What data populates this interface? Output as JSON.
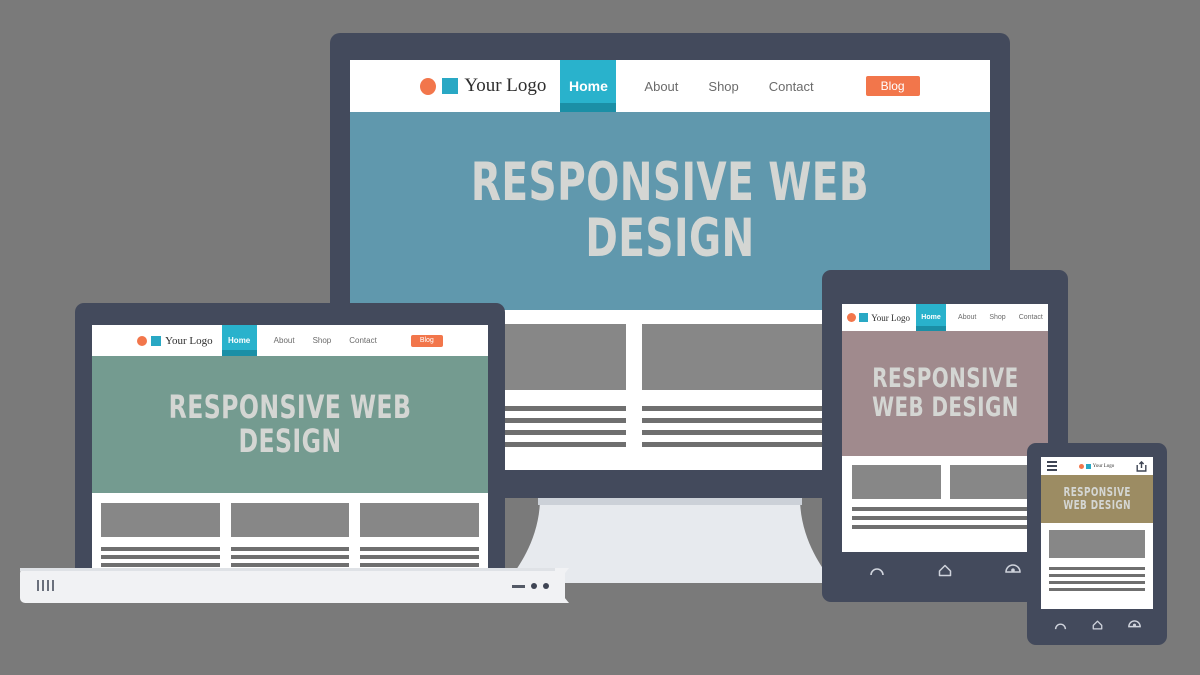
{
  "scene": {
    "background_color": "#7a7a7a",
    "bezel_color": "#434a5c"
  },
  "brand": {
    "logo_text": "Your Logo",
    "logo_dot_color": "#f2764b",
    "logo_square_color": "#29a8c4",
    "accent_color": "#f2764b",
    "active_nav_color": "#29b2cc"
  },
  "hero": {
    "title": "RESPONSIVE WEB DESIGN",
    "title_two_line": "RESPONSIVE\nWEB DESIGN",
    "text_color": "#d4d6d3"
  },
  "nav": {
    "home": "Home",
    "about": "About",
    "shop": "Shop",
    "contact": "Contact",
    "blog": "Blog"
  },
  "devices": {
    "desktop": {
      "name": "Desktop monitor",
      "hero_color": "#6098ad",
      "stand_color": "#e7eaee",
      "columns": 3,
      "text_lines_per_column": 4
    },
    "laptop": {
      "name": "Laptop",
      "hero_color": "#749b90",
      "base_color": "#f1f2f4",
      "columns": 3,
      "text_lines_per_column": 4
    },
    "tablet": {
      "name": "Tablet",
      "hero_color": "#a08a8d",
      "columns": 2,
      "text_lines_per_column": 3,
      "nav_buttons": [
        "back-icon",
        "home-icon",
        "recents-icon"
      ]
    },
    "phone": {
      "name": "Smartphone",
      "hero_color": "#9c8c63",
      "columns": 1,
      "text_lines_per_column": 4,
      "menu_icon": "hamburger-icon",
      "action_icon": "share-icon",
      "nav_buttons": [
        "back-icon",
        "home-icon",
        "recents-icon"
      ]
    }
  }
}
